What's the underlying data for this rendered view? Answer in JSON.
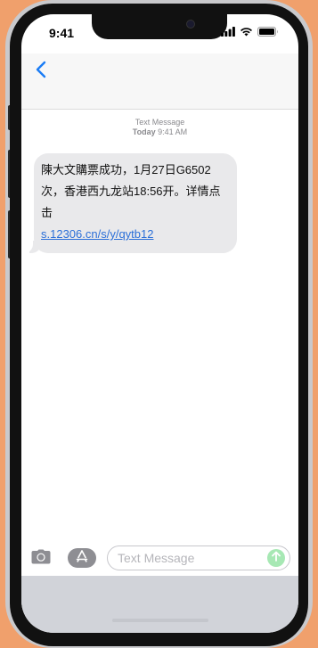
{
  "status_bar": {
    "time": "9:41",
    "icons": [
      "cellular-signal-icon",
      "wifi-icon",
      "battery-icon"
    ]
  },
  "nav": {
    "back_icon": "chevron-left-icon"
  },
  "conversation": {
    "service_label": "Text Message",
    "day": "Today",
    "time": "9:41 AM",
    "message": {
      "text": "陳大文購票成功，1月27日G6502次，香港西九龙站18:56开。详情点击",
      "link": "s.12306.cn/s/y/qytb12"
    }
  },
  "input_bar": {
    "camera_icon": "camera-icon",
    "apps_icon": "app-store-icon",
    "placeholder": "Text Message",
    "value": "",
    "send_icon": "arrow-up-icon"
  },
  "colors": {
    "background": "#f0a06c",
    "accent": "#1a7cf5",
    "bubble": "#e9e9eb",
    "link": "#2b6fd8",
    "send": "#a7e8b4"
  }
}
